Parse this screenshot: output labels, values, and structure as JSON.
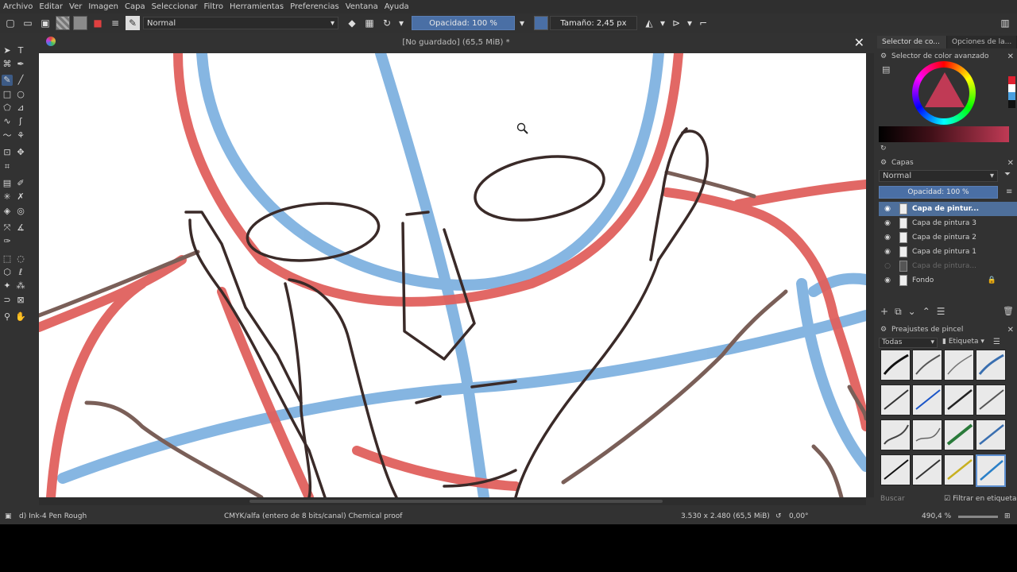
{
  "menu": [
    "Archivo",
    "Editar",
    "Ver",
    "Imagen",
    "Capa",
    "Seleccionar",
    "Filtro",
    "Herramientas",
    "Preferencias",
    "Ventana",
    "Ayuda"
  ],
  "toolbar": {
    "blend_mode": "Normal",
    "opacity": "Opacidad: 100 %",
    "size": "Tamaño: 2,45 px"
  },
  "document": {
    "title": "[No guardado]  (65,5 MiB) *"
  },
  "panels": {
    "tab1": "Selector de co...",
    "tab2": "Opciones de la...",
    "color_selector": "Selector de color avanzado",
    "layers_title": "Capas",
    "layer_blend": "Normal",
    "layer_opacity": "Opacidad:  100 %",
    "brush_title": "Preajustes de pincel",
    "brush_filter": "Todas",
    "brush_tag": "Etiqueta",
    "search_placeholder": "Buscar",
    "filter_label": "Filtrar en etiqueta"
  },
  "layers": [
    {
      "name": "Capa de pintur...",
      "selected": true
    },
    {
      "name": "Capa de pintura 3"
    },
    {
      "name": "Capa de pintura 2"
    },
    {
      "name": "Capa de pintura 1"
    },
    {
      "name": "Capa de pintura...",
      "hidden": true
    },
    {
      "name": "Fondo",
      "locked": true
    }
  ],
  "status": {
    "brush": "d) Ink-4 Pen Rough",
    "colorspace": "CMYK/alfa (entero de 8 bits/canal)  Chemical proof",
    "dimensions": "3.530 x 2.480 (65,5 MiB)",
    "rotation": "0,00°",
    "zoom": "490,4 %"
  },
  "colors": {
    "accent": "#4a6fa5",
    "sketch_red": "#e0605d",
    "sketch_blue": "#7fb2e0",
    "ink": "#3a2a28",
    "brown": "#7a5f58"
  }
}
